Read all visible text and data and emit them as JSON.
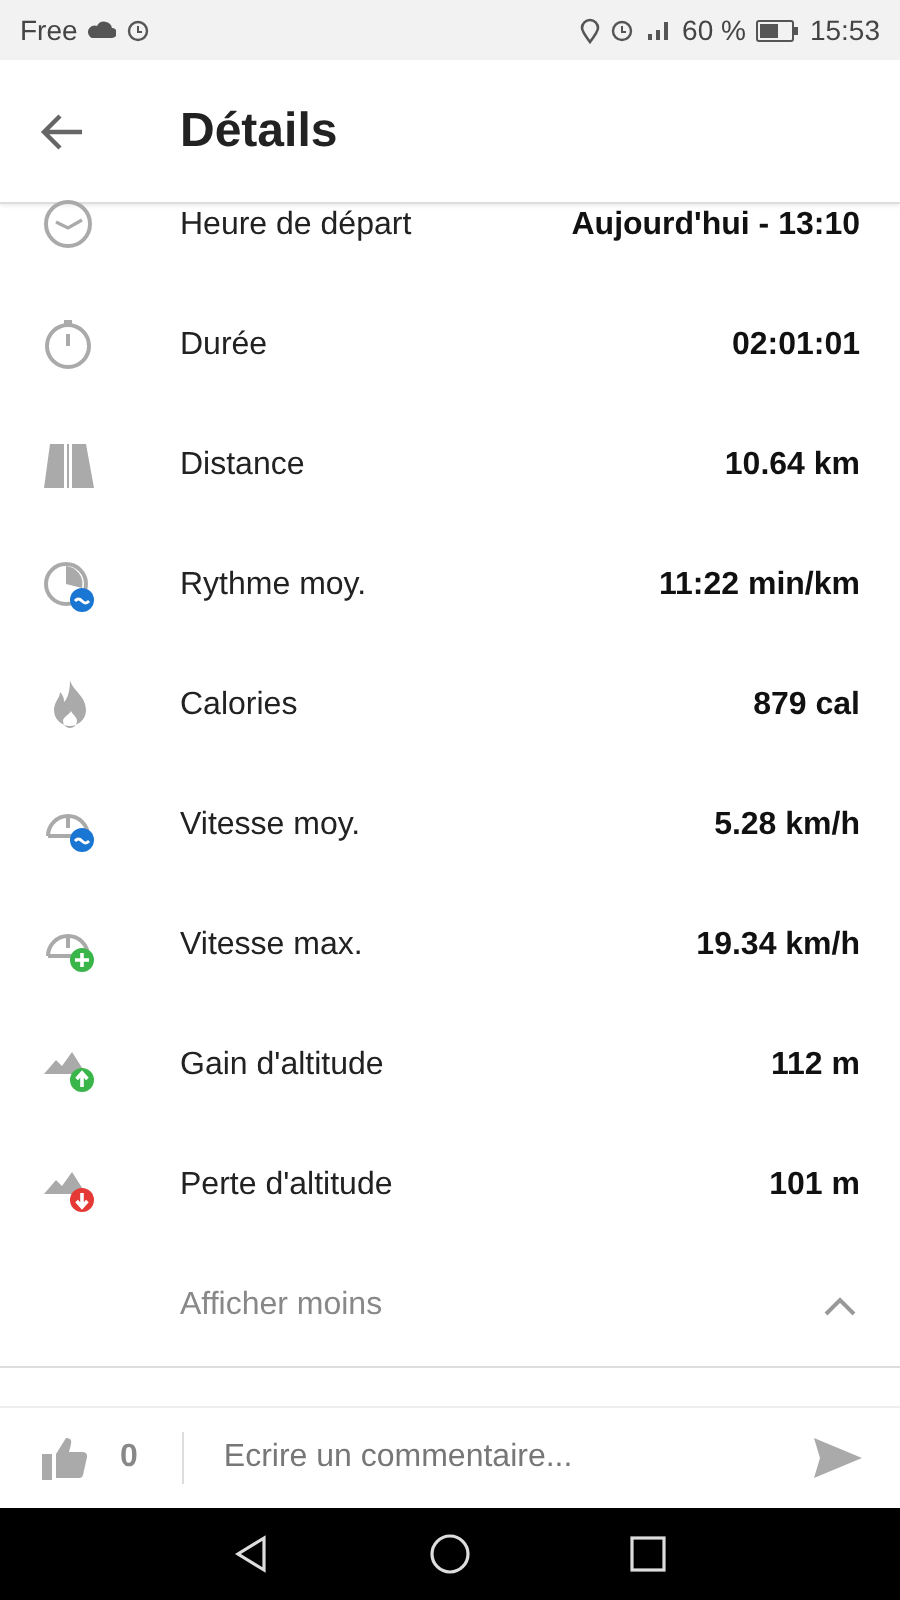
{
  "status_bar": {
    "carrier": "Free",
    "battery": "60 %",
    "time": "15:53"
  },
  "app_bar": {
    "title": "Détails"
  },
  "rows": [
    {
      "kind": "time",
      "label": "Heure de départ",
      "value": "Aujourd'hui - 13:10"
    },
    {
      "kind": "duration",
      "label": "Durée",
      "value": "02:01:01"
    },
    {
      "kind": "distance",
      "label": "Distance",
      "value": "10.64 km"
    },
    {
      "kind": "pace",
      "label": "Rythme moy.",
      "value": "11:22 min/km"
    },
    {
      "kind": "calories",
      "label": "Calories",
      "value": "879 cal"
    },
    {
      "kind": "speed_avg",
      "label": "Vitesse moy.",
      "value": "5.28 km/h"
    },
    {
      "kind": "speed_max",
      "label": "Vitesse max.",
      "value": "19.34 km/h"
    },
    {
      "kind": "ascent",
      "label": "Gain d'altitude",
      "value": "112 m"
    },
    {
      "kind": "descent",
      "label": "Perte d'altitude",
      "value": "101 m"
    }
  ],
  "toggle": {
    "label": "Afficher moins",
    "expanded": true
  },
  "comment_bar": {
    "likes": "0",
    "placeholder": "Ecrire un commentaire..."
  }
}
